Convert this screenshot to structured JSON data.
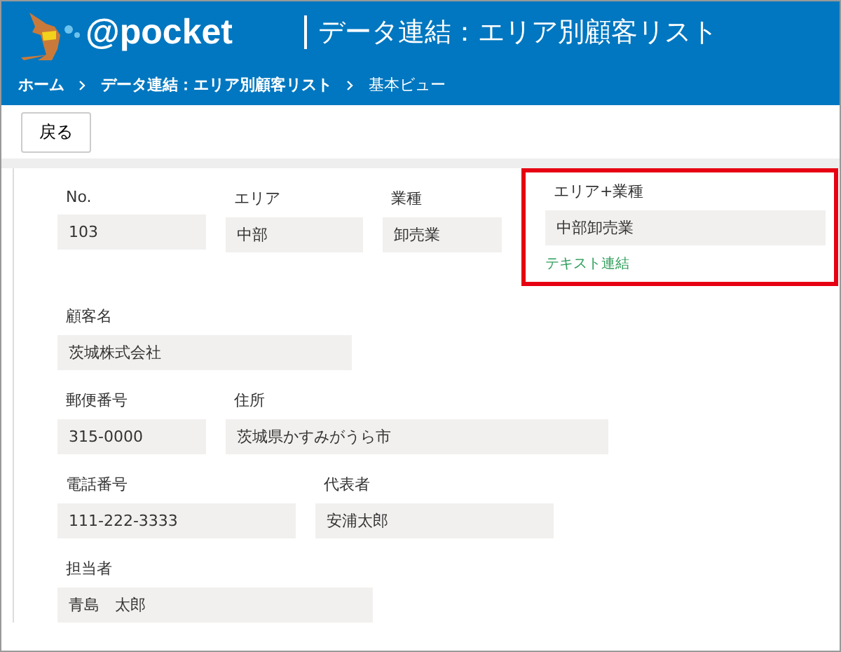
{
  "header": {
    "logo_text": "@pocket",
    "title": "データ連結：エリア別顧客リスト"
  },
  "breadcrumbs": [
    "ホーム",
    "データ連結：エリア別顧客リスト",
    "基本ビュー"
  ],
  "back_button": "戻る",
  "rows": [
    {
      "fields": [
        {
          "label": "No.",
          "value": "103",
          "highlighted": false
        },
        {
          "label": "エリア",
          "value": "中部",
          "highlighted": false
        },
        {
          "label": "業種",
          "value": "卸売業",
          "highlighted": false
        },
        {
          "label": "エリア+業種",
          "value": "中部卸売業",
          "highlighted": true,
          "note": "テキスト連結"
        }
      ]
    },
    {
      "fields": [
        {
          "label": "顧客名",
          "value": "茨城株式会社",
          "highlighted": false
        }
      ]
    },
    {
      "fields": [
        {
          "label": "郵便番号",
          "value": "315-0000",
          "highlighted": false
        },
        {
          "label": "住所",
          "value": "茨城県かすみがうら市",
          "highlighted": false
        }
      ]
    },
    {
      "fields": [
        {
          "label": "電話番号",
          "value": "111-222-3333",
          "highlighted": false
        },
        {
          "label": "代表者",
          "value": "安浦太郎",
          "highlighted": false
        }
      ]
    },
    {
      "fields": [
        {
          "label": "担当者",
          "value": "青島　太郎",
          "highlighted": false
        }
      ]
    }
  ]
}
